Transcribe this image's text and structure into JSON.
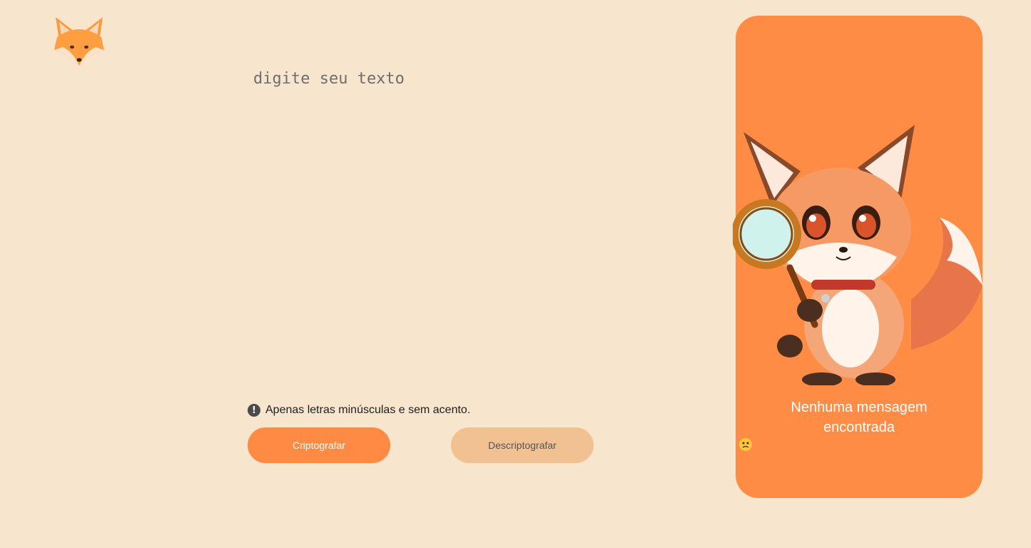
{
  "logo": {
    "icon": "fox-head-icon"
  },
  "editor": {
    "placeholder": "digite seu texto",
    "value": ""
  },
  "hint": {
    "icon": "exclamation-circle-icon",
    "text": "Apenas letras minúsculas e sem acento."
  },
  "buttons": {
    "encrypt_label": "Criptografar",
    "decrypt_label": "Descriptografar"
  },
  "output_panel": {
    "illustration": "fox-with-magnifying-glass",
    "message_line1": "Nenhuma mensagem",
    "message_line2": "encontrada",
    "emoji": "confused-face-emoji"
  },
  "colors": {
    "background": "#F7E5CD",
    "accent": "#FF8A43",
    "secondary_button": "#F2C192",
    "panel": "#FF8C45"
  }
}
